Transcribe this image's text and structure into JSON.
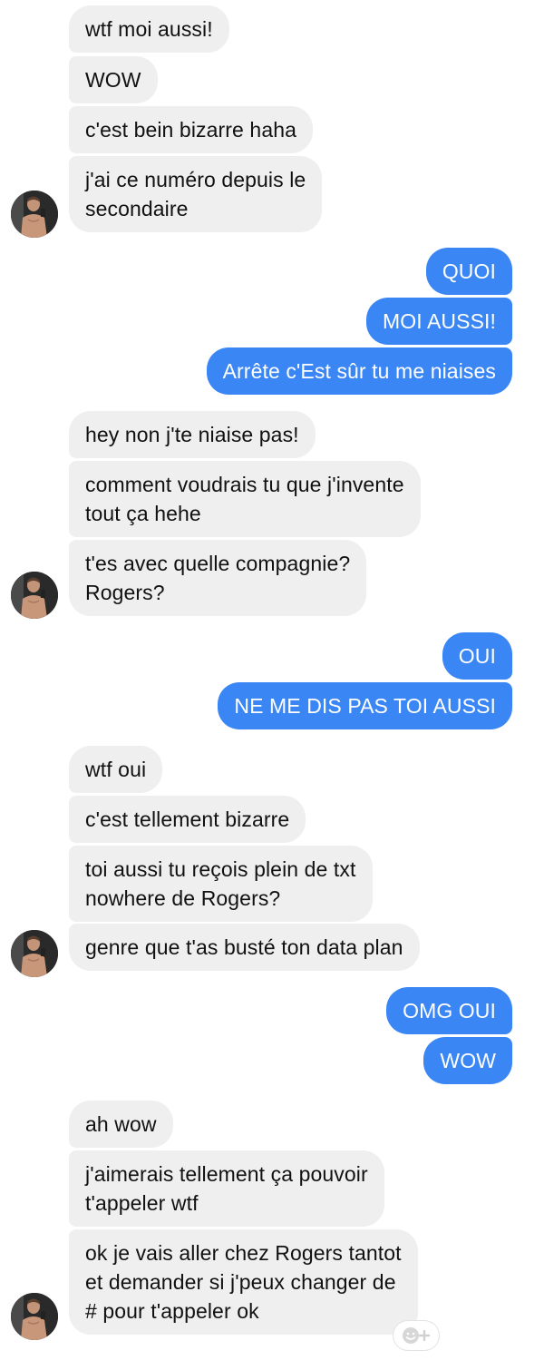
{
  "messages": [
    {
      "side": "recv",
      "text": "wtf moi aussi!"
    },
    {
      "side": "recv",
      "text": "WOW"
    },
    {
      "side": "recv",
      "text": "c'est bein bizarre haha"
    },
    {
      "side": "recv",
      "text": "j'ai ce numéro depuis le\nsecondaire"
    },
    {
      "side": "sent",
      "text": "QUOI"
    },
    {
      "side": "sent",
      "text": "MOI AUSSI!"
    },
    {
      "side": "sent",
      "text": "Arrête c'Est sûr tu me niaises"
    },
    {
      "side": "recv",
      "text": "hey non j'te niaise pas!"
    },
    {
      "side": "recv",
      "text": "comment voudrais tu que j'invente\ntout ça hehe"
    },
    {
      "side": "recv",
      "text": "t'es avec quelle compagnie?\nRogers?"
    },
    {
      "side": "sent",
      "text": "OUI"
    },
    {
      "side": "sent",
      "text": "NE ME DIS PAS TOI AUSSI"
    },
    {
      "side": "recv",
      "text": "wtf oui"
    },
    {
      "side": "recv",
      "text": "c'est tellement bizarre"
    },
    {
      "side": "recv",
      "text": "toi aussi tu reçois plein de txt\nnowhere de Rogers?"
    },
    {
      "side": "recv",
      "text": "genre que t'as busté ton data plan"
    },
    {
      "side": "sent",
      "text": "OMG OUI"
    },
    {
      "side": "sent",
      "text": "WOW"
    },
    {
      "side": "recv",
      "text": "ah wow"
    },
    {
      "side": "recv",
      "text": "j'aimerais tellement ça pouvoir\nt'appeler wtf"
    },
    {
      "side": "recv",
      "text": "ok je vais aller chez Rogers tantot\net demander si j'peux changer de\n# pour t'appeler ok"
    }
  ],
  "icons": {
    "avatar": "contact-avatar",
    "reaction": "add-reaction-icon"
  },
  "colors": {
    "sent_bubble": "#3a86f5",
    "received_bubble": "#efefef"
  }
}
